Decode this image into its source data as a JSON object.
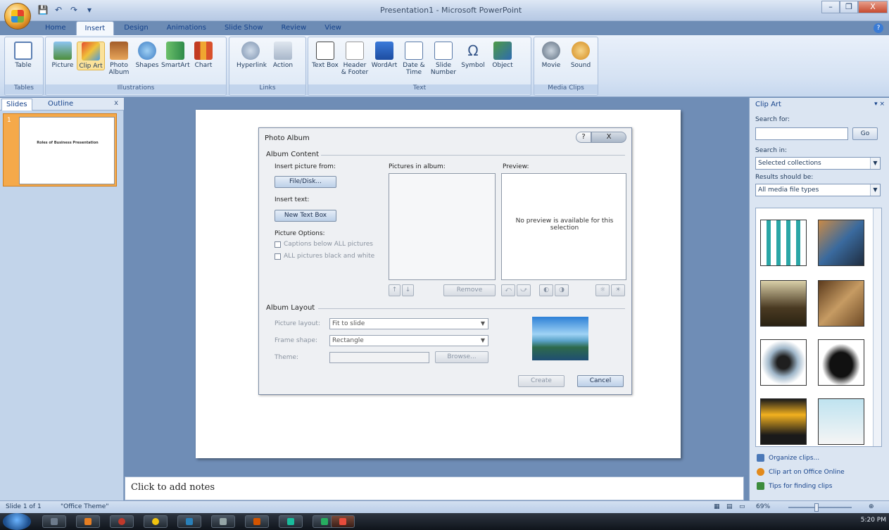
{
  "window": {
    "title": "Presentation1 - Microsoft PowerPoint",
    "controls": [
      "–",
      "❐",
      "X"
    ]
  },
  "quick_access": [
    "💾",
    "↶",
    "↷",
    "▾"
  ],
  "tabs": [
    "Home",
    "Insert",
    "Design",
    "Animations",
    "Slide Show",
    "Review",
    "View"
  ],
  "active_tab": "Insert",
  "ribbon": {
    "groups": [
      {
        "label": "Tables",
        "buttons": [
          "Table"
        ]
      },
      {
        "label": "Illustrations",
        "buttons": [
          "Picture",
          "Clip Art",
          "Photo Album",
          "Shapes",
          "SmartArt",
          "Chart"
        ]
      },
      {
        "label": "Links",
        "buttons": [
          "Hyperlink",
          "Action"
        ]
      },
      {
        "label": "Text",
        "buttons": [
          "Text Box",
          "Header & Footer",
          "WordArt",
          "Date & Time",
          "Slide Number",
          "Symbol",
          "Object"
        ]
      },
      {
        "label": "Media Clips",
        "buttons": [
          "Movie",
          "Sound"
        ]
      }
    ]
  },
  "left_pane": {
    "tabs": [
      "Slides",
      "Outline"
    ],
    "close": "x",
    "slide_number": "1",
    "thumb_text": "Roles of Business Presentation"
  },
  "dialog": {
    "title": "Photo Album",
    "help": "?",
    "close": "X",
    "album_content": "Album Content",
    "insert_picture_from": "Insert picture from:",
    "file_disk": "File/Disk...",
    "insert_text": "Insert text:",
    "new_text_box": "New Text Box",
    "picture_options": "Picture Options:",
    "captions_below": "Captions below ALL pictures",
    "all_black_white": "ALL pictures black and white",
    "pictures_in_album": "Pictures in album:",
    "preview": "Preview:",
    "no_preview": "No preview is available for this selection",
    "remove": "Remove",
    "album_layout": "Album Layout",
    "picture_layout_label": "Picture layout:",
    "picture_layout_value": "Fit to slide",
    "frame_shape_label": "Frame shape:",
    "frame_shape_value": "Rectangle",
    "theme_label": "Theme:",
    "browse": "Browse...",
    "create": "Create",
    "cancel": "Cancel",
    "tool_buttons": [
      "↑",
      "↓",
      "⤺",
      "⤻",
      "◐",
      "◑",
      "☼",
      "☀"
    ]
  },
  "notes": {
    "placeholder": "Click to add notes"
  },
  "clip_art": {
    "title": "Clip Art",
    "controls": "▾ ×",
    "search_for": "Search for:",
    "search_value": "",
    "go": "Go",
    "search_in": "Search in:",
    "search_in_value": "Selected collections",
    "results_should_be": "Results should be:",
    "results_value": "All media file types",
    "links": [
      "Organize clips...",
      "Clip art on Office Online",
      "Tips for finding clips"
    ]
  },
  "status": {
    "slide": "Slide 1 of 1",
    "theme": "\"Office Theme\"",
    "zoom": "69%",
    "time": "5:20 PM"
  },
  "colors": {
    "accent": "#15428b",
    "ribbon": "#d5e2f3",
    "workspace": "#6f8db6",
    "selected": "#fbe29a"
  }
}
